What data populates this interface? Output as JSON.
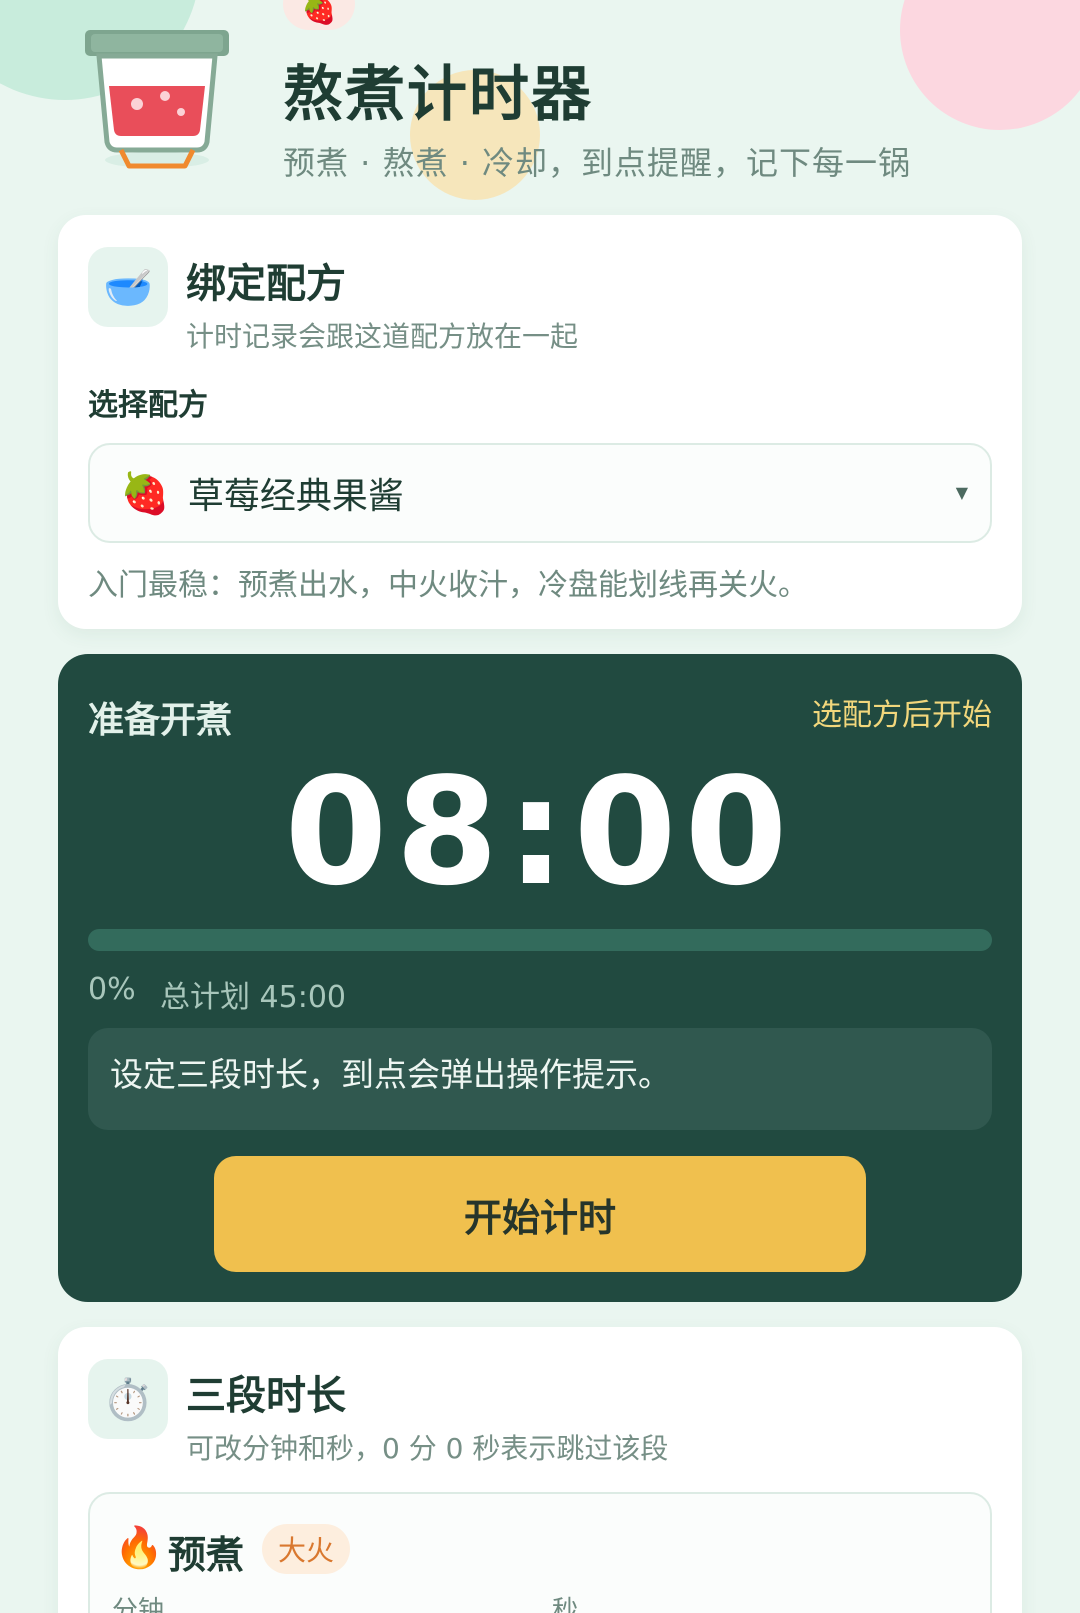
{
  "header": {
    "title": "熬煮计时器",
    "subtitle": "预煮 · 熬煮 · 冷却，到点提醒，记下每一锅",
    "badge_emoji": "🍓"
  },
  "recipe_card": {
    "icon": "🥣",
    "title": "绑定配方",
    "subtitle": "计时记录会跟这道配方放在一起",
    "field_label": "选择配方",
    "selected_emoji": "🍓",
    "selected": "草莓经典果酱",
    "tip": "入门最稳：预煮出水，中火收汁，冷盘能划线再关火。"
  },
  "timer": {
    "state": "准备开煮",
    "hint": "选配方后开始",
    "clock": "08:00",
    "progress_percent": 0,
    "progress_label": "0%",
    "total_label": "总计划 45:00",
    "message": "设定三段时长，到点会弹出操作提示。",
    "start_label": "开始计时"
  },
  "stages_card": {
    "icon": "⏱️",
    "title": "三段时长",
    "subtitle": "可改分钟和秒，0 分 0 秒表示跳过该段",
    "stage": {
      "icon": "🔥",
      "name": "预煮",
      "badge": "大火",
      "min_label": "分钟",
      "sec_label": "秒"
    }
  },
  "colors": {
    "background": "#eaf6f0",
    "timer_panel": "#214a40",
    "accent_yellow": "#f0c04e",
    "text_dark": "#1f3d33"
  }
}
